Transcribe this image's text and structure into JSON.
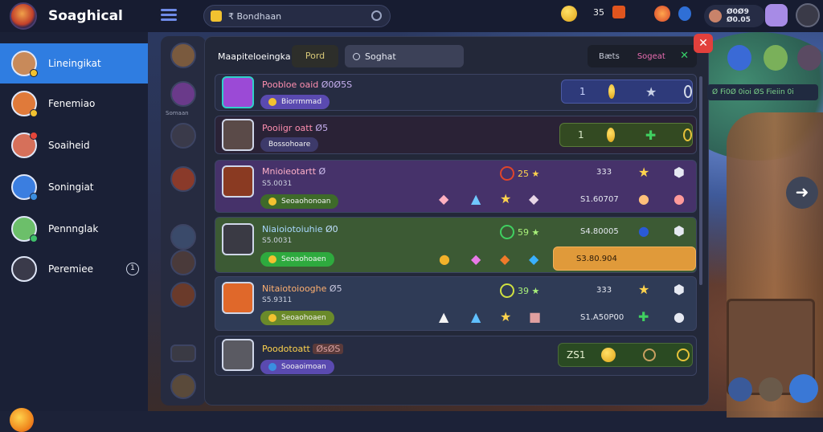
{
  "app": {
    "brand": "Soaghical"
  },
  "topbar": {
    "search_text": "₹ Bondhaan",
    "res1": "35",
    "pill_line1": "Ø0Ø9",
    "pill_line2": "Ø0.05"
  },
  "sidebar": {
    "items": [
      {
        "label": "Lineingikat",
        "active": true,
        "avatar_color": "#c88a5a",
        "dot_color": "#f2c230"
      },
      {
        "label": "Fenemiao",
        "active": false,
        "avatar_color": "#e07a3a",
        "dot_color": "#f2c230"
      },
      {
        "label": "Soaiheid",
        "active": false,
        "avatar_color": "#d6705a",
        "dot_color": "#e5463a"
      },
      {
        "label": "Soningiat",
        "active": false,
        "avatar_color": "#3b7ee0",
        "dot_color": "#3b8ee0"
      },
      {
        "label": "Pennnglak",
        "active": false,
        "avatar_color": "#6cbf6a",
        "dot_color": "#3fc06a"
      },
      {
        "label": "Peremiee",
        "active": false,
        "avatar_color": "#3a3a4a",
        "dot_color": "",
        "badge": "1"
      }
    ]
  },
  "strip": {
    "label": "Somaan"
  },
  "modal": {
    "title": "Maapiteloeingka",
    "tab": "Pord",
    "search": "Soghat",
    "filter1": "Bæts",
    "filter2": "Sogeat",
    "close": "✕",
    "filter_close": "✕"
  },
  "rows": [
    {
      "name": "Poobloe oaid",
      "tag": "Ø0Ø5S",
      "badge": "Biorrmmad",
      "box_num": "1"
    },
    {
      "name": "Pooiigr oatt",
      "tag": "Ø5",
      "badge": "Bossohoare",
      "box_num": "1"
    },
    {
      "name": "Mnioieotartt",
      "tag": "Ø",
      "sub": "S5.0031",
      "badge": "Seoaohonoan",
      "level": "25",
      "val1": "333",
      "val2": "S1.60707"
    },
    {
      "name": "Niaioiotoiuhie",
      "tag": "Ø0",
      "sub": "S5.0031",
      "badge": "Seoaohoaen",
      "level": "59",
      "val1": "S4.80005",
      "val2": "S3.80.904"
    },
    {
      "name": "Nitaiotoiooghe",
      "tag": "Ø5",
      "sub": "S5.9311",
      "badge": "Seoaohoaen",
      "level": "39",
      "val1": "333",
      "val2": "S1.A50P00"
    },
    {
      "name": "Poodotoatt",
      "tag": "ØsØS",
      "badge": "Sooaoimoan",
      "box_num": "ZS1"
    }
  ],
  "right": {
    "pill": "Ø Fi0Ø 0ioi ØS Fieiin 0i"
  },
  "colors": {
    "accent": "#2f7de1",
    "gold": "#f2c230",
    "close": "#e2403c"
  }
}
